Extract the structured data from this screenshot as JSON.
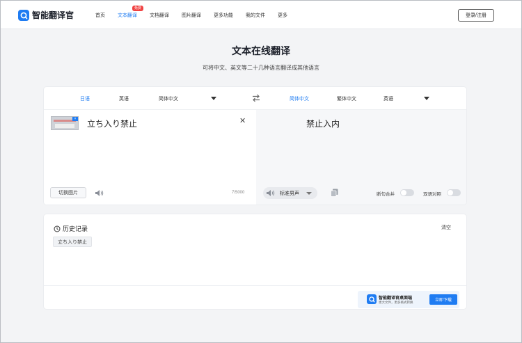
{
  "brand": {
    "name": "智能翻译官",
    "accent": "#1f7cf2",
    "badge_color": "#f04141"
  },
  "nav": {
    "items": [
      {
        "label": "首页"
      },
      {
        "label": "文本翻译",
        "badge": "免费"
      },
      {
        "label": "文档翻译"
      },
      {
        "label": "图片翻译"
      },
      {
        "label": "更多功能"
      },
      {
        "label": "我的文件"
      },
      {
        "label": "更多"
      }
    ],
    "active_item": "文本翻译",
    "login_label": "登录/注册"
  },
  "page": {
    "title": "文本在线翻译",
    "subtitle": "可将中文、英文等二十几种语言翻译成其他语言"
  },
  "translator": {
    "source_langs": [
      "日语",
      "英语",
      "简体中文"
    ],
    "source_active": "日语",
    "target_langs": [
      "简体中文",
      "繁体中文",
      "英语"
    ],
    "target_active": "简体中文",
    "source_text": "立ち入り禁止",
    "target_text": "禁止入内",
    "switch_image_label": "切换图片",
    "char_count": "7/5000",
    "voice_label": "标准男声",
    "sentence_merge_label": "断句合并",
    "bilingual_label": "双语对照",
    "sentence_merge_on": false,
    "bilingual_on": false
  },
  "history": {
    "title": "历史记录",
    "clear_label": "清空",
    "items": [
      "立ち入り禁止"
    ]
  },
  "promo": {
    "title": "智能翻译官桌面端",
    "subtitle": "更大文件，更多格式转换",
    "button_label": "立即下载"
  }
}
